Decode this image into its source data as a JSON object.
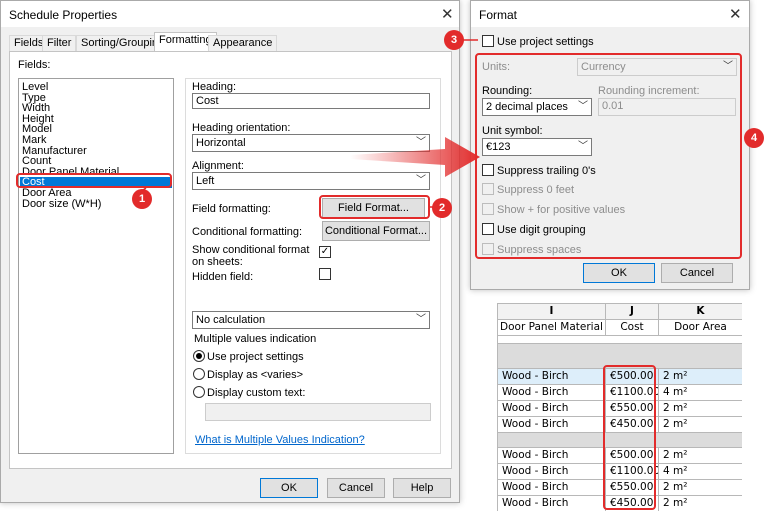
{
  "schedule_dialog": {
    "title": "Schedule Properties",
    "tabs": [
      "Fields",
      "Filter",
      "Sorting/Grouping",
      "Formatting",
      "Appearance"
    ],
    "fields_label": "Fields:",
    "fields": [
      "Level",
      "Type",
      "Width",
      "Height",
      "Model",
      "Mark",
      "Manufacturer",
      "Count",
      "Door Panel Material",
      "Cost",
      "Door Area",
      "Door size (W*H)"
    ],
    "selected_field": "Cost",
    "heading_label": "Heading:",
    "heading_value": "Cost",
    "heading_orientation_label": "Heading orientation:",
    "heading_orientation_value": "Horizontal",
    "alignment_label": "Alignment:",
    "alignment_value": "Left",
    "field_formatting_label": "Field formatting:",
    "field_format_button": "Field Format...",
    "conditional_formatting_label": "Conditional formatting:",
    "conditional_format_button": "Conditional Format...",
    "show_conditional_label": "Show conditional format on sheets:",
    "hidden_field_label": "Hidden field:",
    "calculation_value": "No calculation",
    "multiple_values_label": "Multiple values indication",
    "radio_options": [
      "Use project settings",
      "Display as <varies>",
      "Display custom text:"
    ],
    "help_link": "What is Multiple Values Indication?",
    "buttons": {
      "ok": "OK",
      "cancel": "Cancel",
      "help": "Help"
    }
  },
  "format_dialog": {
    "title": "Format",
    "use_project_settings": "Use project settings",
    "units_label": "Units:",
    "units_value": "Currency",
    "rounding_label": "Rounding:",
    "rounding_value": "2 decimal places",
    "rounding_increment_label": "Rounding increment:",
    "rounding_increment_value": "0.01",
    "unit_symbol_label": "Unit symbol:",
    "unit_symbol_value": "€123",
    "options": [
      {
        "label": "Suppress trailing 0's",
        "enabled": true
      },
      {
        "label": "Suppress 0 feet",
        "enabled": false
      },
      {
        "label": "Show + for positive values",
        "enabled": false
      },
      {
        "label": "Use digit grouping",
        "enabled": true
      },
      {
        "label": "Suppress spaces",
        "enabled": false
      }
    ],
    "buttons": {
      "ok": "OK",
      "cancel": "Cancel"
    }
  },
  "schedule_table": {
    "columns": [
      "I",
      "J",
      "K"
    ],
    "headers": [
      "Door Panel Material",
      "Cost",
      "Door Area"
    ],
    "group1": [
      [
        "Wood - Birch",
        "€500.00",
        "2 m²"
      ],
      [
        "Wood - Birch",
        "€1100.00",
        "4 m²"
      ],
      [
        "Wood - Birch",
        "€550.00",
        "2 m²"
      ],
      [
        "Wood - Birch",
        "€450.00",
        "2 m²"
      ]
    ],
    "group2": [
      [
        "Wood - Birch",
        "€500.00",
        "2 m²"
      ],
      [
        "Wood - Birch",
        "€1100.00",
        "4 m²"
      ],
      [
        "Wood - Birch",
        "€550.00",
        "2 m²"
      ],
      [
        "Wood - Birch",
        "€450.00",
        "2 m²"
      ]
    ]
  },
  "callouts": [
    "1",
    "2",
    "3",
    "4"
  ],
  "colors": {
    "accent_red": "#e22b2b",
    "selection_blue": "#0078d7",
    "row_highlight": "#ddeefa"
  }
}
